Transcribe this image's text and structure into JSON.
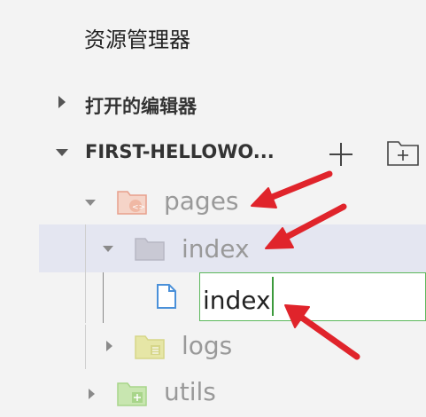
{
  "explorer": {
    "title": "资源管理器",
    "open_editors_label": "打开的编辑器",
    "root_folder_label": "FIRST-HELLOWO..."
  },
  "tree": {
    "pages": "pages",
    "index_folder": "index",
    "logs": "logs",
    "utils": "utils"
  },
  "rename": {
    "value": "index"
  },
  "colors": {
    "selection": "#e4e6f1",
    "input_border": "#5cb85c",
    "annotation_arrow": "#e0242b",
    "pages_icon": "#e8a08c",
    "index_icon": "#b7b7c4",
    "logs_icon": "#d6d688",
    "utils_icon": "#a8d58a",
    "file_icon": "#4a90d9"
  },
  "icons": [
    "plus-icon",
    "new-folder-icon",
    "folder-icon",
    "file-icon",
    "chevron-right-icon",
    "chevron-down-icon",
    "arrow-annotation-icon"
  ]
}
